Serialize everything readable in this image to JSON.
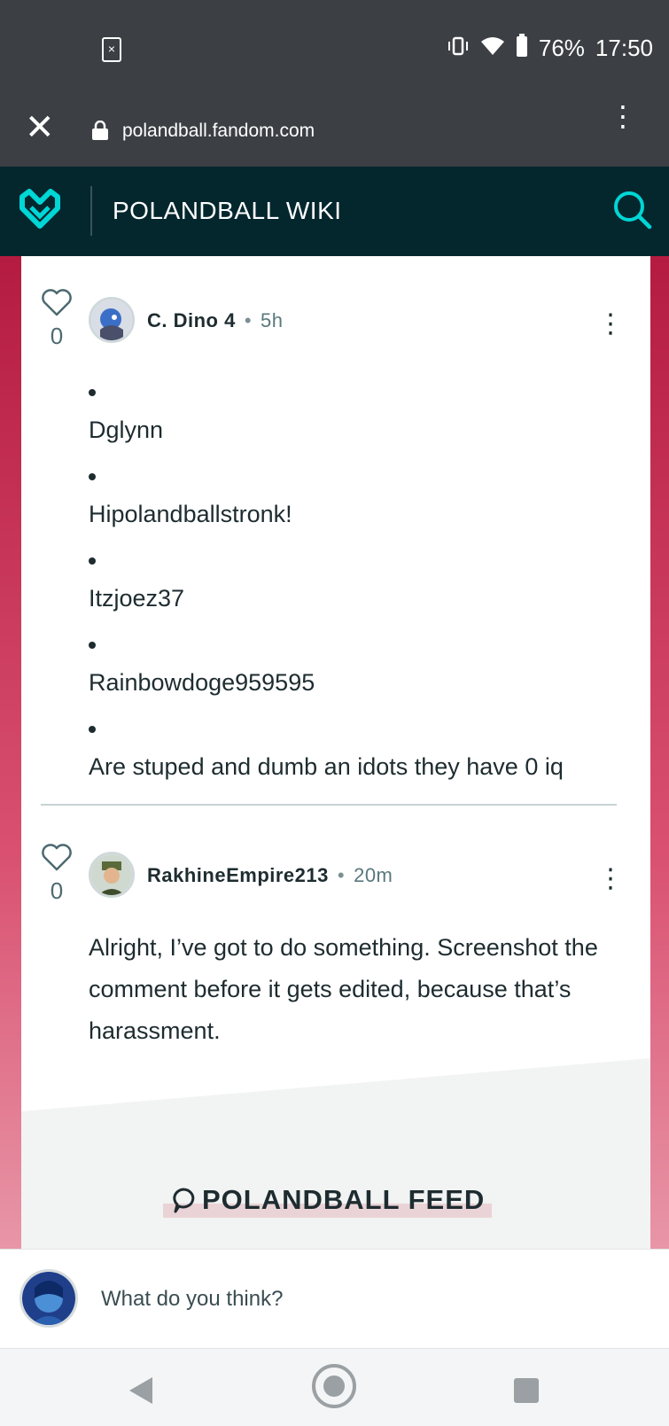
{
  "status_bar": {
    "battery": "76%",
    "time": "17:50"
  },
  "browser": {
    "url": "polandball.fandom.com"
  },
  "wiki_header": {
    "title": "POLANDBALL WIKI"
  },
  "comments": [
    {
      "author": "C. Dino 4",
      "time": "5h",
      "likes": "0",
      "bullets": [
        "Dglynn",
        "Hipolandballstronk!",
        "Itzjoez37",
        "Rainbowdoge959595",
        "Are stuped and dumb an idots they have 0 iq"
      ]
    },
    {
      "author": "RakhineEmpire213",
      "time": "20m",
      "likes": "0",
      "text": "Alright, I’ve got to do something. Screenshot the comment before it gets edited, because that’s harassment."
    }
  ],
  "feed": {
    "title": "POLANDBALL FEED"
  },
  "composer": {
    "placeholder": "What do you think?"
  },
  "colors": {
    "header_bg": "#04272e",
    "accent": "#00d6d6",
    "page_bg_top": "#b51b41"
  }
}
